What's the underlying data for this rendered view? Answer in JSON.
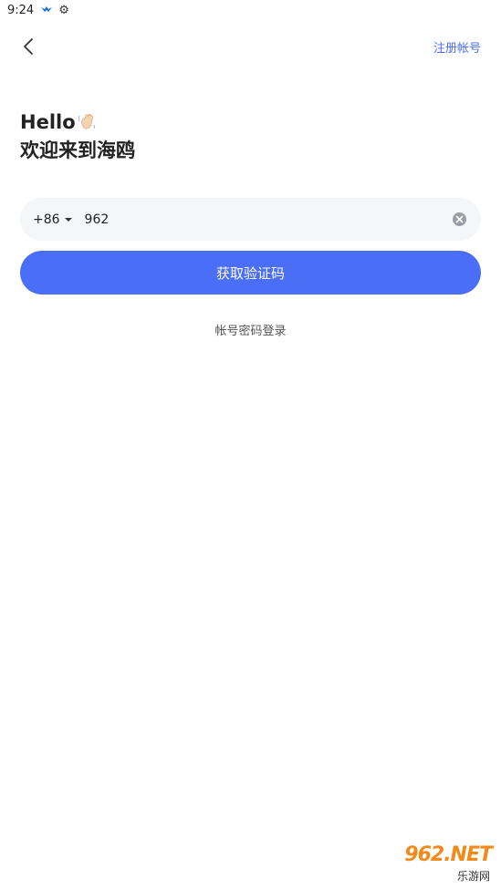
{
  "status_bar": {
    "time": "9:24"
  },
  "header": {
    "register_label": "注册帐号"
  },
  "greeting": {
    "hello": "Hello",
    "welcome": "欢迎来到海鸥"
  },
  "phone": {
    "country_code": "+86",
    "value": "962"
  },
  "actions": {
    "get_code_label": "获取验证码",
    "password_login_label": "帐号密码登录"
  },
  "watermark": {
    "logo_text": "962.NET",
    "site_text": "乐游网"
  },
  "icons": {
    "back": "chevron-left-icon",
    "clear": "clear-circle-icon",
    "caret": "caret-down-icon",
    "wave": "waving-hand-icon"
  },
  "colors": {
    "accent": "#4a6ef5",
    "link": "#4a6cf7",
    "input_bg": "#f5f6f8"
  }
}
